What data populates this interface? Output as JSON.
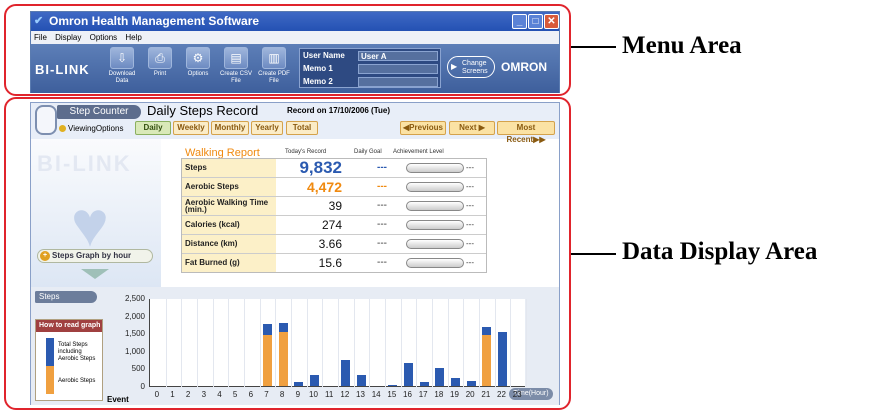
{
  "window": {
    "title": "Omron Health Management Software"
  },
  "menu": [
    "File",
    "Display",
    "Options",
    "Help"
  ],
  "toolbar": {
    "logo": "BI-LINK",
    "buttons": [
      {
        "label": "Download Data",
        "icon": "download-icon"
      },
      {
        "label": "Print",
        "icon": "print-icon"
      },
      {
        "label": "Options",
        "icon": "options-icon"
      },
      {
        "label": "Create CSV File",
        "icon": "csv-icon"
      },
      {
        "label": "Create PDF File",
        "icon": "pdf-icon"
      }
    ],
    "user_label": "User Name",
    "user_value": "User A",
    "memo1_label": "Memo 1",
    "memo1_value": "",
    "memo2_label": "Memo 2",
    "memo2_value": "",
    "change_screens": "Change Screens",
    "brand": "OMRON"
  },
  "callouts": {
    "menu": "Menu Area",
    "data": "Data Display Area"
  },
  "header": {
    "tab": "Step Counter",
    "title": "Daily Steps Record",
    "record": "Record on 17/10/2006 (Tue)",
    "viewing_options": "ViewingOptions",
    "views": [
      "Daily",
      "Weekly",
      "Monthly",
      "Yearly",
      "Total"
    ],
    "active_view": "Daily",
    "previous": "Previous",
    "next": "Next",
    "most_recent": "Most Recent"
  },
  "left": {
    "logo": "BI-LINK",
    "graph_button": "Steps Graph by hour"
  },
  "report": {
    "title": "Walking Report",
    "col_today": "Today's Record",
    "col_goal": "Daily Goal",
    "col_level": "Achievement Level",
    "rows": [
      {
        "label": "Steps",
        "value": "9,832",
        "goal": "---",
        "level": "---"
      },
      {
        "label": "Aerobic Steps",
        "value": "4,472",
        "goal": "---",
        "level": "---"
      },
      {
        "label": "Aerobic Walking Time (min.)",
        "value": "39",
        "goal": "---",
        "level": "---"
      },
      {
        "label": "Calories (kcal)",
        "value": "274",
        "goal": "---",
        "level": "---"
      },
      {
        "label": "Distance (km)",
        "value": "3.66",
        "goal": "---",
        "level": "---"
      },
      {
        "label": "Fat Burned (g)",
        "value": "15.6",
        "goal": "---",
        "level": "---"
      }
    ]
  },
  "graph": {
    "label": "Steps",
    "how_to": "How to read graph",
    "legend_total": "Total Steps including Aerobic Steps",
    "legend_aerobic": "Aerobic Steps",
    "event": "Event",
    "time_label": "Time(Hour)"
  },
  "chart_data": {
    "type": "bar",
    "title": "",
    "xlabel": "Time(Hour)",
    "ylabel": "Steps",
    "ylim": [
      0,
      2500
    ],
    "yticks": [
      "2,500",
      "2,000",
      "1,500",
      "1,000",
      "500",
      "0"
    ],
    "categories": [
      "0",
      "1",
      "2",
      "3",
      "4",
      "5",
      "6",
      "7",
      "8",
      "9",
      "10",
      "11",
      "12",
      "13",
      "14",
      "15",
      "16",
      "17",
      "18",
      "19",
      "20",
      "21",
      "22",
      "23"
    ],
    "series": [
      {
        "name": "Total Steps",
        "color": "#2b5ab0",
        "values": [
          0,
          0,
          0,
          0,
          0,
          0,
          0,
          1750,
          1780,
          120,
          320,
          0,
          730,
          300,
          0,
          20,
          640,
          120,
          520,
          230,
          130,
          1680,
          1530,
          0
        ]
      },
      {
        "name": "Aerobic Steps",
        "color": "#f0a040",
        "values": [
          0,
          0,
          0,
          0,
          0,
          0,
          0,
          1440,
          1540,
          0,
          0,
          0,
          0,
          0,
          0,
          0,
          0,
          0,
          0,
          0,
          0,
          1460,
          0,
          0
        ]
      }
    ]
  }
}
